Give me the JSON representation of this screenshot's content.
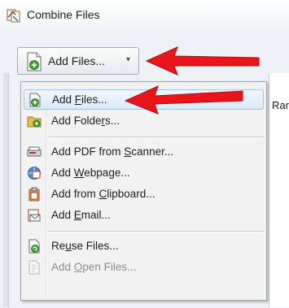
{
  "window": {
    "title": "Combine Files"
  },
  "toolbar": {
    "add_files_button": "Add Files...",
    "caret": "▾"
  },
  "background_text": {
    "partial_column": "Ran"
  },
  "menu": {
    "items": [
      {
        "label": "Add Files...",
        "underline_char": "F",
        "icon": "add-files-icon",
        "highlighted": true,
        "disabled": false
      },
      {
        "label": "Add Folders...",
        "underline_char": "r",
        "icon": "add-folder-icon",
        "highlighted": false,
        "disabled": false
      },
      {
        "label": "Add PDF from Scanner...",
        "underline_char": "S",
        "icon": "scanner-icon",
        "highlighted": false,
        "disabled": false
      },
      {
        "label": "Add Webpage...",
        "underline_char": "W",
        "icon": "webpage-icon",
        "highlighted": false,
        "disabled": false
      },
      {
        "label": "Add from Clipboard...",
        "underline_char": "C",
        "icon": "clipboard-icon",
        "highlighted": false,
        "disabled": false
      },
      {
        "label": "Add Email...",
        "underline_char": "E",
        "icon": "email-icon",
        "highlighted": false,
        "disabled": false
      },
      {
        "label": "Reuse Files...",
        "underline_char": "u",
        "icon": "reuse-files-icon",
        "highlighted": false,
        "disabled": false
      },
      {
        "label": "Add Open Files...",
        "underline_char": "O",
        "icon": "open-files-icon",
        "highlighted": false,
        "disabled": true
      }
    ]
  },
  "colors": {
    "arrow": "#e8161b",
    "highlight_border": "#a6c4e8",
    "add_icon_green": "#3fa535"
  }
}
